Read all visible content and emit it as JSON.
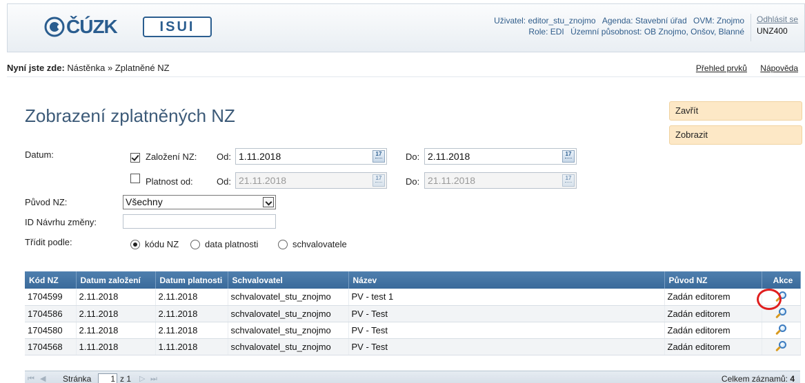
{
  "header": {
    "logo_cuzk": "ČÚZK",
    "logo_isui": "ISUI",
    "user_line": "Uživatel: editor_stu_znojmo",
    "agenda_line": "Agenda: Stavební úřad",
    "ovm_line": "OVM: Znojmo",
    "role_line": "Role: EDI",
    "territory_line": "Územní působnost: OB Znojmo, Onšov, Blanné",
    "logout_label": "Odhlásit se",
    "user_code": "UNZ400"
  },
  "breadcrumb": {
    "prefix": "Nyní jste zde:",
    "path": "Nástěnka » Zplatněné NZ"
  },
  "top_links": {
    "overview": "Přehled prvků",
    "help": "Nápověda"
  },
  "page_title": "Zobrazení zplatněných NZ",
  "side_buttons": {
    "close": "Zavřít",
    "show": "Zobrazit"
  },
  "form": {
    "date_label": "Datum:",
    "created": {
      "checked": true,
      "label": "Založení NZ:",
      "from_label": "Od:",
      "from_value": "1.11.2018",
      "to_label": "Do:",
      "to_value": "2.11.2018"
    },
    "valid": {
      "checked": false,
      "label": "Platnost od:",
      "from_label": "Od:",
      "from_value": "21.11.2018",
      "to_label": "Do:",
      "to_value": "21.11.2018"
    },
    "calendar_text": "17",
    "origin_label": "Původ NZ:",
    "origin_value": "Všechny",
    "id_label": "ID Návrhu změny:",
    "id_value": "",
    "sort_label": "Třídit podle:",
    "sort_options": [
      "kódu NZ",
      "data platnosti",
      "schvalovatele"
    ],
    "sort_selected": 0
  },
  "table": {
    "columns": [
      "Kód NZ",
      "Datum založení",
      "Datum platnosti",
      "Schvalovatel",
      "Název",
      "Původ NZ",
      "Akce"
    ],
    "rows": [
      {
        "code": "1704599",
        "created": "2.11.2018",
        "valid": "2.11.2018",
        "approver": "schvalovatel_stu_znojmo",
        "name": "PV - test 1",
        "origin": "Zadán editorem"
      },
      {
        "code": "1704586",
        "created": "2.11.2018",
        "valid": "2.11.2018",
        "approver": "schvalovatel_stu_znojmo",
        "name": "PV - Test",
        "origin": "Zadán editorem"
      },
      {
        "code": "1704580",
        "created": "2.11.2018",
        "valid": "2.11.2018",
        "approver": "schvalovatel_stu_znojmo",
        "name": "PV - Test",
        "origin": "Zadán editorem"
      },
      {
        "code": "1704568",
        "created": "1.11.2018",
        "valid": "1.11.2018",
        "approver": "schvalovatel_stu_znojmo",
        "name": "PV - Test",
        "origin": "Zadán editorem"
      }
    ]
  },
  "pager": {
    "first": "⏮",
    "prev": "◀",
    "page_label": "Stránka",
    "page_value": "1",
    "of_label": "z 1",
    "next": "▷",
    "last": "⏭",
    "total_label": "Celkem záznamů:",
    "total_value": "4"
  },
  "colors": {
    "header_blue": "#2a5d8f",
    "table_header": "#4476a6",
    "button_bg": "#fde8c6",
    "highlight_ring": "#e01e1e"
  }
}
